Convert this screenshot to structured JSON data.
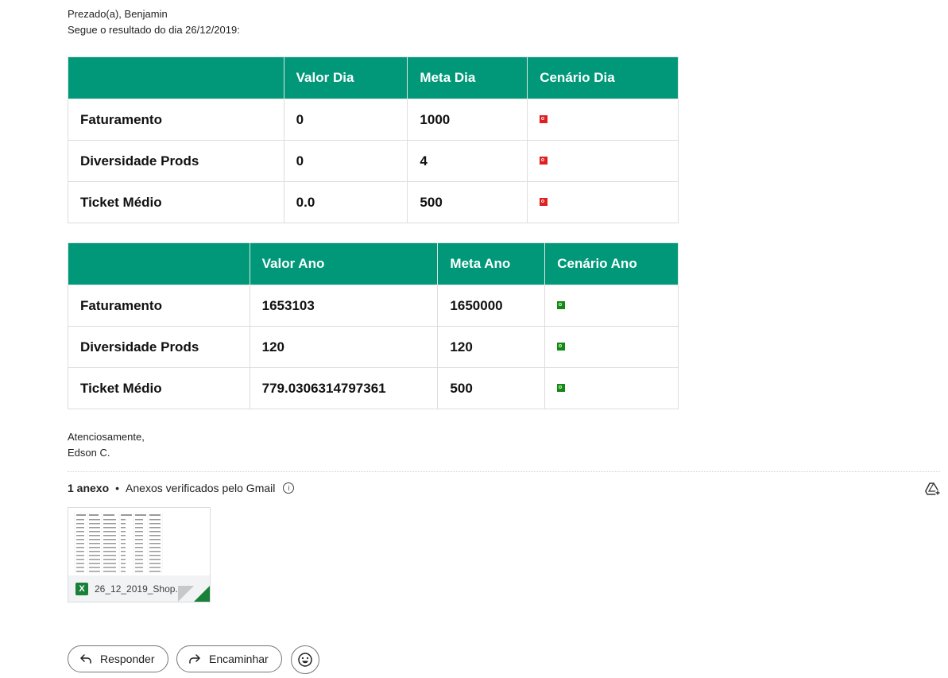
{
  "email": {
    "greeting_line1": "Prezado(a), Benjamin",
    "greeting_line2": "Segue o resultado do dia 26/12/2019:",
    "closing_line1": "Atenciosamente,",
    "closing_line2": "Edson C."
  },
  "day_table": {
    "headers": [
      "",
      "Valor Dia",
      "Meta Dia",
      "Cenário Dia"
    ],
    "rows": [
      {
        "label": "Faturamento",
        "value": "0",
        "meta": "1000",
        "status": "red"
      },
      {
        "label": "Diversidade Prods",
        "value": "0",
        "meta": "4",
        "status": "red"
      },
      {
        "label": "Ticket Médio",
        "value": "0.0",
        "meta": "500",
        "status": "red"
      }
    ]
  },
  "year_table": {
    "headers": [
      "",
      "Valor Ano",
      "Meta Ano",
      "Cenário Ano"
    ],
    "rows": [
      {
        "label": "Faturamento",
        "value": "1653103",
        "meta": "1650000",
        "status": "green"
      },
      {
        "label": "Diversidade Prods",
        "value": "120",
        "meta": "120",
        "status": "green"
      },
      {
        "label": "Ticket Médio",
        "value": "779.0306314797361",
        "meta": "500",
        "status": "green"
      }
    ]
  },
  "attachments": {
    "count_label": "1 anexo",
    "separator": "•",
    "verified_label": "Anexos verificados pelo Gmail",
    "file_name": "26_12_2019_Shop...",
    "file_type_badge": "X"
  },
  "actions": {
    "reply_label": "Responder",
    "forward_label": "Encaminhar"
  },
  "colors": {
    "header_green": "#009879",
    "status_red": "#e02020",
    "status_green": "#138a13",
    "excel_green": "#188038"
  },
  "icons": {
    "reply": "reply-icon",
    "forward": "forward-icon",
    "emoji": "emoji-icon",
    "info": "info-icon",
    "drive": "add-to-drive-icon"
  }
}
